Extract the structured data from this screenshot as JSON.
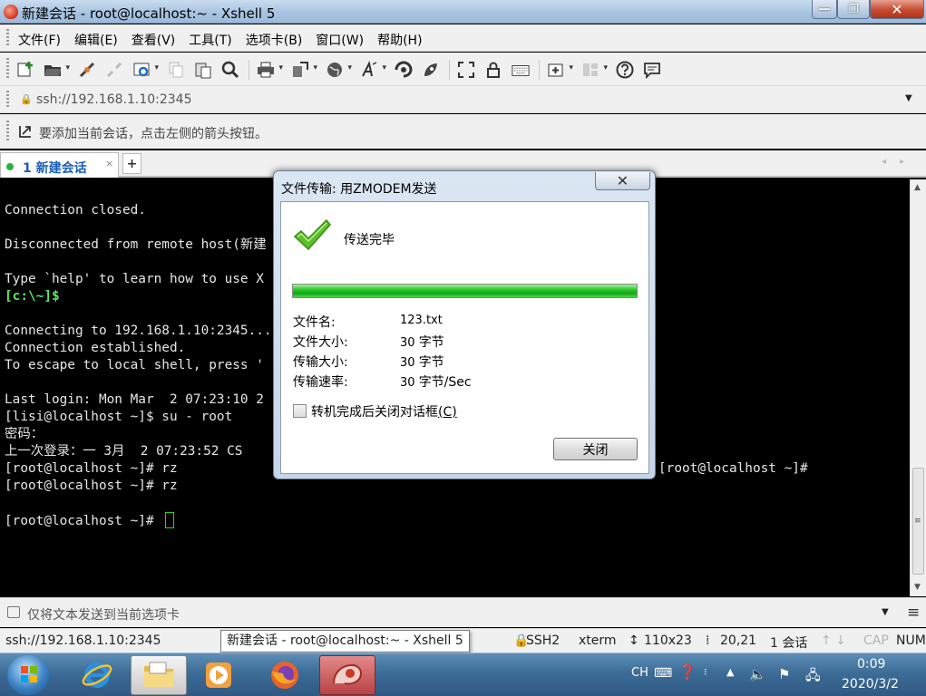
{
  "window": {
    "title": "新建会话 - root@localhost:~ - Xshell 5",
    "min_label": "—",
    "max_label": "❐",
    "close_label": "✕"
  },
  "menu": [
    "文件(F)",
    "编辑(E)",
    "查看(V)",
    "工具(T)",
    "选项卡(B)",
    "窗口(W)",
    "帮助(H)"
  ],
  "toolbar": {
    "icons": [
      "new-session-icon",
      "open-folder-icon",
      "connect-icon",
      "disconnect-icon",
      "properties-icon",
      "copy-icon",
      "paste-icon",
      "find-icon",
      "print-icon",
      "transfer-icon",
      "globe-icon",
      "font-icon",
      "xftp-icon",
      "xmanager-icon",
      "fullscreen-icon",
      "lock-icon",
      "keyboard-icon",
      "add-tab-icon",
      "layout-icon",
      "help-icon",
      "chat-icon"
    ]
  },
  "address": {
    "value": "ssh://192.168.1.10:2345"
  },
  "hint": {
    "text": "要添加当前会话，点击左侧的箭头按钮。"
  },
  "tabs": [
    {
      "label": "1 新建会话",
      "close": "×"
    }
  ],
  "tab_add": "+",
  "tab_nav": "◂ ▸",
  "terminal": {
    "lines": [
      "Connection closed.",
      "",
      "Disconnected from remote host(新建",
      "",
      "Type `help' to learn how to use X",
      "[c:\\~]$",
      "",
      "Connecting to 192.168.1.10:2345...",
      "Connection established.",
      "To escape to local shell, press '",
      "",
      "Last login: Mon Mar  2 07:23:10 2",
      "[lisi@localhost ~]$ su - root",
      "密码：",
      "上一次登录：一 3月  2 07:23:52 CS",
      "[root@localhost ~]# rz",
      "[root@localhost ~]# rz",
      "",
      "[root@localhost ~]# "
    ],
    "right_fragment": "[root@localhost ~]#"
  },
  "send_bar": {
    "text": "仅将文本发送到当前选项卡",
    "menu_icon": "≡"
  },
  "status": {
    "host": "ssh://192.168.1.10:2345",
    "protocol": "SSH2",
    "term": "xterm",
    "size": "110x23",
    "cursor": "20,21",
    "sessions": "1 会话",
    "cap": "CAP",
    "num": "NUM",
    "tooltip": "新建会话 - root@localhost:~ - Xshell 5"
  },
  "dialog": {
    "title": "文件传输: 用ZMODEM发送",
    "close_label": "✕",
    "status": "传送完毕",
    "progress_percent": 100,
    "fields": [
      {
        "label": "文件名:",
        "value": "123.txt",
        "unit": ""
      },
      {
        "label": "文件大小:",
        "value": "30",
        "unit": "字节"
      },
      {
        "label": "传输大小:",
        "value": "30",
        "unit": "字节"
      },
      {
        "label": "传输速率:",
        "value": "30",
        "unit": "字节/Sec"
      }
    ],
    "checkbox_label": "转机完成后关闭对话框",
    "checkbox_accel": "(C)",
    "checkbox_checked": false,
    "close_button": "关闭"
  },
  "taskbar": {
    "ime": "CH",
    "time": "0:09",
    "date": "2020/3/2"
  },
  "colors": {
    "terminal_bg": "#000000",
    "terminal_fg": "#e6e6e6",
    "prompt_green": "#5ee65e",
    "progress_green": "#22c322",
    "tab_label_blue": "#1a5eb8"
  }
}
